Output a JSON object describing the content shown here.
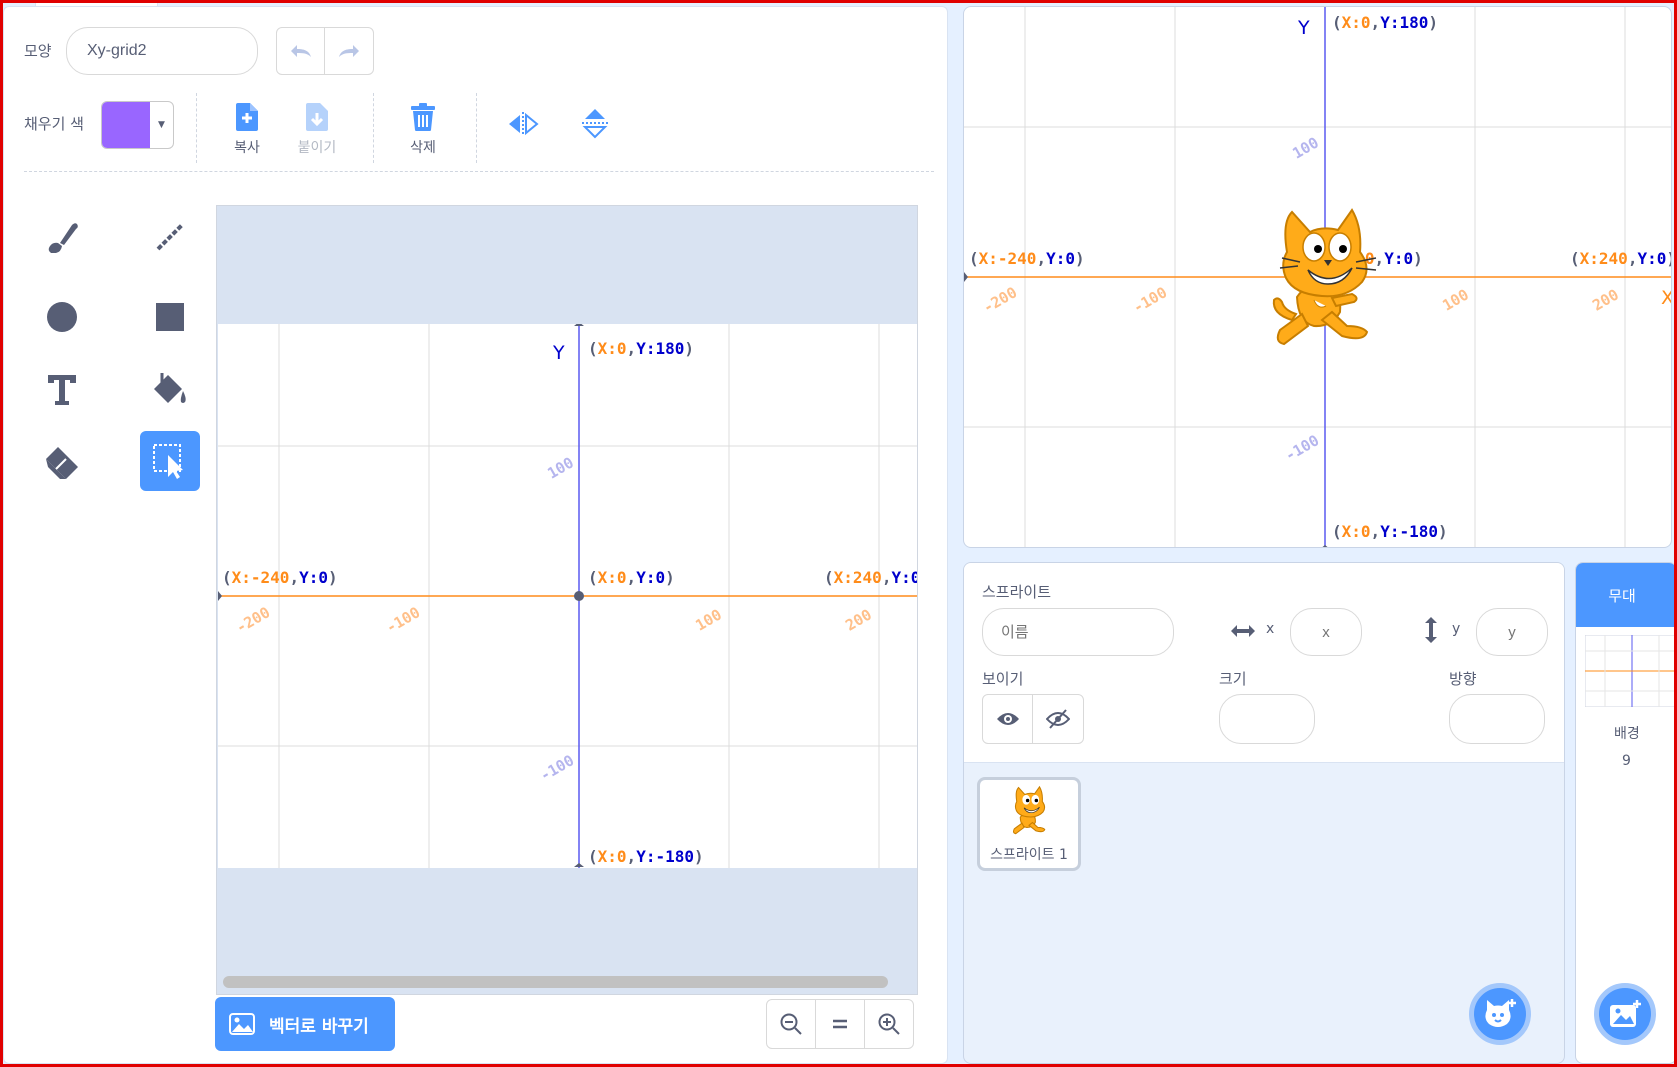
{
  "costume": {
    "label": "모양",
    "name_value": "Xy-grid2"
  },
  "fill": {
    "label": "채우기 색",
    "color": "#9966ff"
  },
  "actions": {
    "copy": "복사",
    "paste": "붙이기",
    "delete": "삭제"
  },
  "grid": {
    "y_axis": "Y",
    "x_axis": "X",
    "top": {
      "x": "0",
      "y": "180"
    },
    "bottom": {
      "x": "0",
      "y": "-180"
    },
    "left": {
      "x": "-240",
      "y": "0"
    },
    "right": {
      "x": "240",
      "y": "0"
    },
    "origin": {
      "x": "0",
      "y": "0"
    },
    "ticks": {
      "m200": "-200",
      "m100": "-100",
      "p100": "100",
      "p200": "200"
    }
  },
  "convert_button": "벡터로 바꾸기",
  "sprite_panel": {
    "sprite_label": "스프라이트",
    "name_placeholder": "이름",
    "x_label": "x",
    "x_placeholder": "x",
    "y_label": "y",
    "y_placeholder": "y",
    "show_label": "보이기",
    "size_label": "크기",
    "direction_label": "방향",
    "sprite_tile_name": "스프라이트 1"
  },
  "stage_panel": {
    "title": "무대",
    "backdrops_label": "배경",
    "backdrops_count": "9"
  },
  "colors": {
    "accent": "#4c97ff",
    "x_axis": "#ff8c1a",
    "y_axis": "#0000cc",
    "panel_bg": "#e5f0ff"
  }
}
